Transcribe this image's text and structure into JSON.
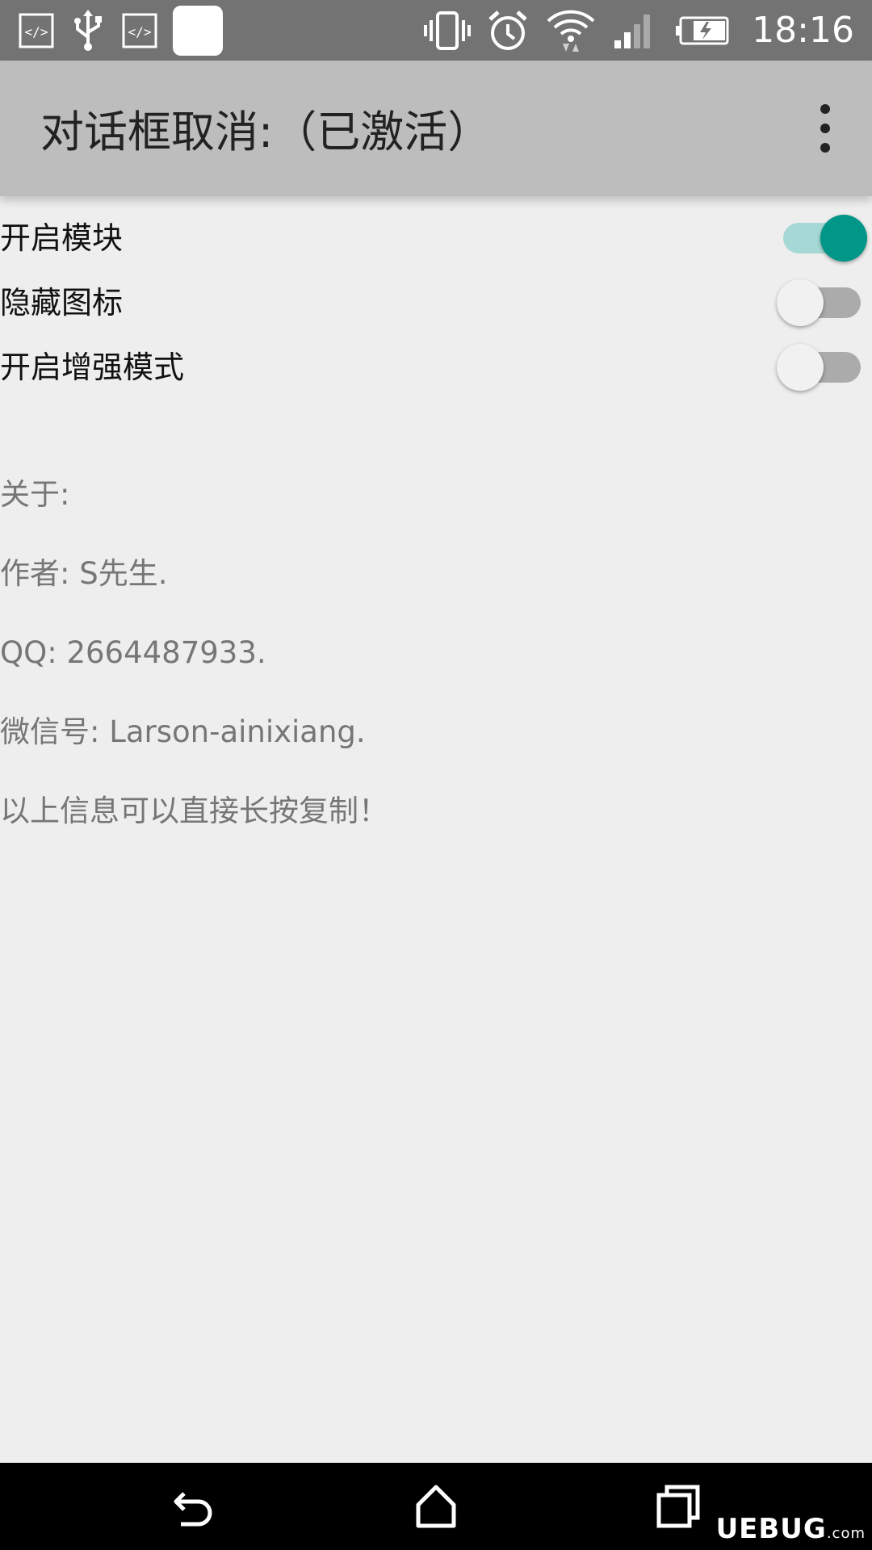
{
  "status_bar": {
    "time": "18:16",
    "left_icons": [
      "code-icon",
      "usb-icon",
      "code-icon",
      "notification-square"
    ],
    "right_icons": [
      "vibrate-icon",
      "alarm-icon",
      "wifi-icon",
      "signal-icon",
      "battery-charging-icon"
    ]
  },
  "app_bar": {
    "title": "对话框取消:（已激活）",
    "menu_icon": "more-vert-icon"
  },
  "settings": [
    {
      "label": "开启模块",
      "enabled": true
    },
    {
      "label": "隐藏图标",
      "enabled": false
    },
    {
      "label": "开启增强模式",
      "enabled": false
    }
  ],
  "about": {
    "lines": [
      "关于:",
      "作者: S先生.",
      "QQ: 2664487933.",
      "微信号: Larson-ainixiang.",
      "以上信息可以直接长按复制！"
    ]
  },
  "nav_bar": {
    "buttons": [
      "back-icon",
      "home-icon",
      "recents-icon"
    ]
  },
  "watermark": {
    "text": "UEBUG",
    "suffix": ".com"
  },
  "colors": {
    "status_bar": "#737373",
    "app_bar": "#bdbdbd",
    "background": "#eeeeee",
    "accent": "#009688",
    "accent_track": "#a6d9d5",
    "switch_off_track": "#ababab"
  }
}
